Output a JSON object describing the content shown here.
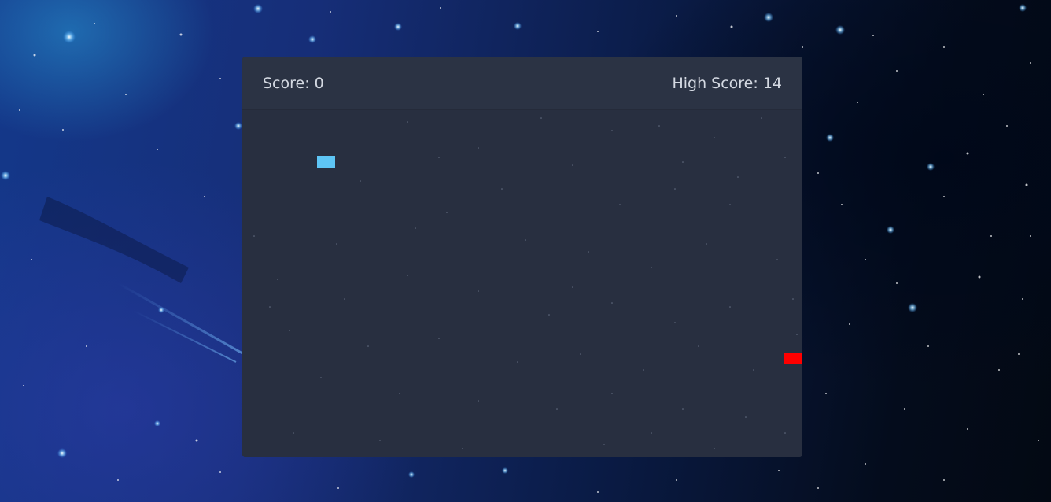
{
  "game": {
    "score_text": "Score: 0",
    "high_score_text": "High Score: 14",
    "score": 0,
    "high_score": 14
  },
  "colors": {
    "panel": "#282e3f",
    "header": "#2b3344",
    "text": "#d4d9e2",
    "player_block": "#5ec5f5",
    "enemy_block": "#ff0000"
  }
}
